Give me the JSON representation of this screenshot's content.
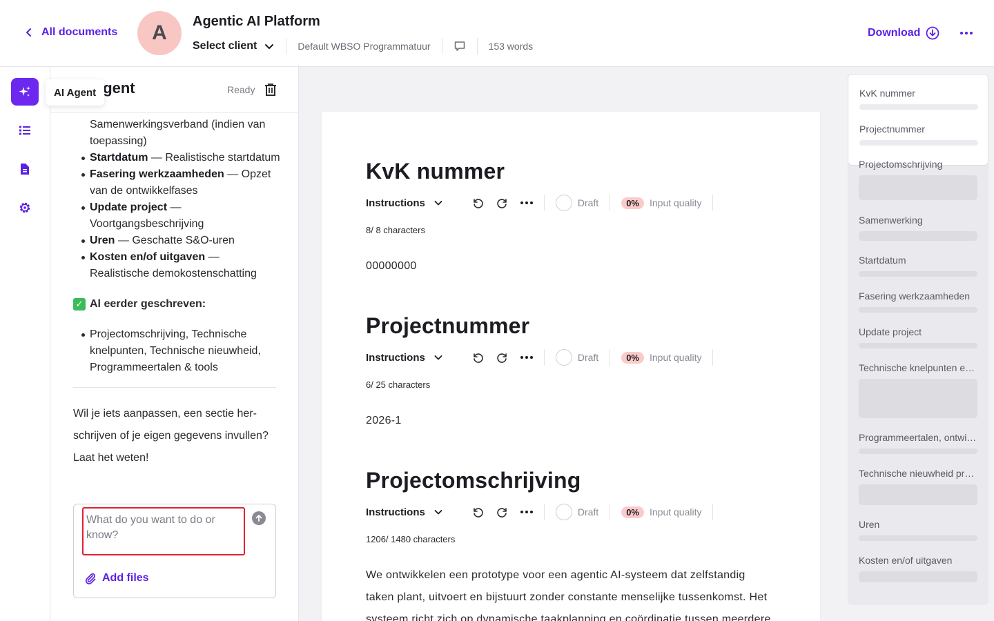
{
  "header": {
    "back_label": "All documents",
    "avatar_letter": "A",
    "title": "Agentic AI Platform",
    "client_select": "Select client",
    "template": "Default WBSO Programmatuur",
    "word_count": "153 words",
    "download_label": "Download"
  },
  "rail": {
    "tooltip": "AI Agent",
    "items": [
      "ai-agent",
      "outline",
      "document",
      "settings"
    ],
    "accent": "#6d28f0"
  },
  "agent": {
    "title": "AI Agent",
    "title_visible": "gent",
    "status": "Ready",
    "items": [
      {
        "bold": "",
        "text": "Samenwerkingsverband (indien van toepassing)"
      },
      {
        "bold": "Startdatum",
        "text": " — Realistische startdatum"
      },
      {
        "bold": "Fasering werkzaamheden",
        "text": " — Opzet van de ontwikkelfases"
      },
      {
        "bold": "Update project",
        "text": " — Voortgangsbeschrijving"
      },
      {
        "bold": "Uren",
        "text": " — Geschatte S&O-uren"
      },
      {
        "bold": "Kosten en/of uitgaven",
        "text": " — Realistische demokostenschatting"
      }
    ],
    "written_heading": "Al eerder geschreven:",
    "written_item": "Projectomschrijving, Technische knelpunten, Technische nieuwheid, Programmeertalen & tools",
    "closing": "Wil je iets aanpassen, een sectie her-schrijven of je eigen gegevens invullen? Laat het weten!",
    "input_placeholder": "What do you want to do or know?",
    "add_files": "Add files"
  },
  "document": {
    "toolbar": {
      "instructions": "Instructions",
      "draft": "Draft",
      "quality_pct": "0%",
      "quality_label": "Input quality"
    },
    "sections": [
      {
        "title": "KvK nummer",
        "chars": "8/ 8 characters",
        "content": "00000000"
      },
      {
        "title": "Projectnummer",
        "chars": "6/ 25 characters",
        "content": "2026-1"
      },
      {
        "title": "Projectomschrijving",
        "chars": "1206/ 1480 characters",
        "content": "We ontwikkelen een prototype voor een agentic AI-systeem dat zelfstandig taken plant, uitvoert en bijstuurt zonder constante menselijke tussenkomst. Het systeem richt zich op dynamische taakplanning en coördinatie tussen meerdere"
      }
    ]
  },
  "outline": {
    "items": [
      "KvK nummer",
      "Projectnummer",
      "Projectomschrijving",
      "Samenwerking",
      "Startdatum",
      "Fasering werkzaamheden",
      "Update project",
      "Technische knelpunten en oplossingen",
      "Programmeertalen, ontwikkeltools",
      "Technische nieuwheid project",
      "Uren",
      "Kosten en/of uitgaven"
    ]
  },
  "colors": {
    "accent": "#5b21e6",
    "quality_badge": "#fbcaca",
    "highlight_border": "#e0212f"
  }
}
